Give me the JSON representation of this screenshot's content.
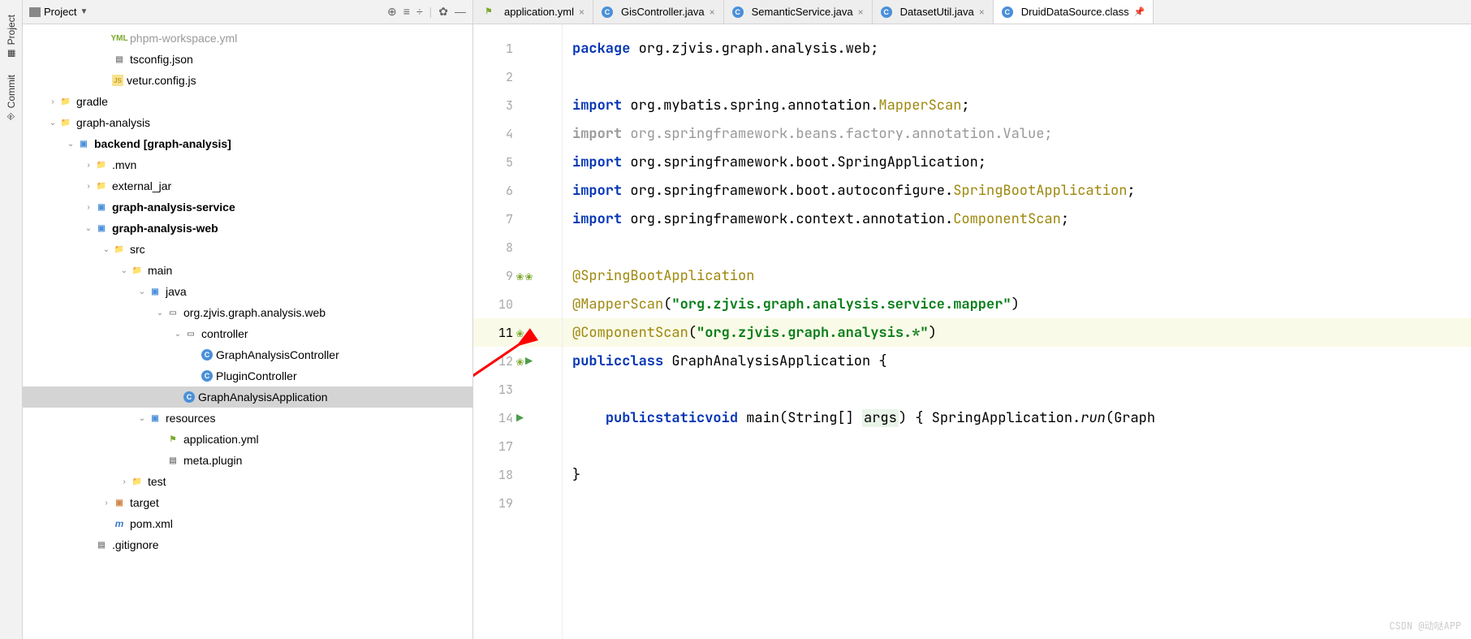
{
  "toolStrip": {
    "project": "Project",
    "commit": "Commit"
  },
  "projectPanel": {
    "title": "Project"
  },
  "tree": [
    {
      "indent": 4,
      "chev": "none",
      "icon": "yml",
      "iconText": "YML",
      "label": "phpm-workspace.yml",
      "faded": true
    },
    {
      "indent": 4,
      "chev": "none",
      "icon": "file",
      "iconText": "",
      "label": "tsconfig.json"
    },
    {
      "indent": 4,
      "chev": "none",
      "icon": "js",
      "iconText": "JS",
      "label": "vetur.config.js"
    },
    {
      "indent": 1,
      "chev": "right",
      "icon": "folder",
      "iconText": "",
      "label": "gradle"
    },
    {
      "indent": 1,
      "chev": "down",
      "icon": "folder",
      "iconText": "",
      "label": "graph-analysis"
    },
    {
      "indent": 2,
      "chev": "down",
      "icon": "module",
      "iconText": "",
      "label": "backend",
      "qualifier": "[graph-analysis]",
      "bold": true
    },
    {
      "indent": 3,
      "chev": "right",
      "icon": "folder",
      "iconText": "",
      "label": ".mvn"
    },
    {
      "indent": 3,
      "chev": "right",
      "icon": "folder",
      "iconText": "",
      "label": "external_jar"
    },
    {
      "indent": 3,
      "chev": "right",
      "icon": "module",
      "iconText": "",
      "label": "graph-analysis-service",
      "bold": true
    },
    {
      "indent": 3,
      "chev": "down",
      "icon": "module",
      "iconText": "",
      "label": "graph-analysis-web",
      "bold": true
    },
    {
      "indent": 4,
      "chev": "down",
      "icon": "folder",
      "iconText": "",
      "label": "src"
    },
    {
      "indent": 5,
      "chev": "down",
      "icon": "folder",
      "iconText": "",
      "label": "main"
    },
    {
      "indent": 6,
      "chev": "down",
      "icon": "src",
      "iconText": "",
      "label": "java"
    },
    {
      "indent": 7,
      "chev": "down",
      "icon": "pkg",
      "iconText": "",
      "label": "org.zjvis.graph.analysis.web"
    },
    {
      "indent": 8,
      "chev": "down",
      "icon": "pkg",
      "iconText": "",
      "label": "controller"
    },
    {
      "indent": 9,
      "chev": "none",
      "icon": "class",
      "iconText": "C",
      "label": "GraphAnalysisController"
    },
    {
      "indent": 9,
      "chev": "none",
      "icon": "class",
      "iconText": "C",
      "label": "PluginController"
    },
    {
      "indent": 8,
      "chev": "none",
      "icon": "class-run",
      "iconText": "C",
      "label": "GraphAnalysisApplication",
      "selected": true
    },
    {
      "indent": 6,
      "chev": "down",
      "icon": "res",
      "iconText": "",
      "label": "resources"
    },
    {
      "indent": 7,
      "chev": "none",
      "icon": "yml",
      "iconText": "",
      "label": "application.yml"
    },
    {
      "indent": 7,
      "chev": "none",
      "icon": "file",
      "iconText": "",
      "label": "meta.plugin"
    },
    {
      "indent": 5,
      "chev": "right",
      "icon": "folder",
      "iconText": "",
      "label": "test"
    },
    {
      "indent": 4,
      "chev": "right",
      "icon": "target",
      "iconText": "",
      "label": "target"
    },
    {
      "indent": 4,
      "chev": "none",
      "icon": "maven",
      "iconText": "m",
      "label": "pom.xml"
    },
    {
      "indent": 3,
      "chev": "none",
      "icon": "file",
      "iconText": "",
      "label": ".gitignore"
    }
  ],
  "editorTabs": [
    {
      "icon": "yml",
      "label": "application.yml",
      "active": false
    },
    {
      "icon": "class",
      "label": "GisController.java",
      "active": false
    },
    {
      "icon": "class",
      "label": "SemanticService.java",
      "active": false
    },
    {
      "icon": "class",
      "label": "DatasetUtil.java",
      "active": false
    },
    {
      "icon": "class",
      "label": "DruidDataSource.class",
      "active": true,
      "pinned": true
    }
  ],
  "code": {
    "lineNumbers": [
      "1",
      "2",
      "3",
      "4",
      "5",
      "6",
      "7",
      "8",
      "9",
      "10",
      "11",
      "12",
      "13",
      "14",
      "17",
      "18",
      "19"
    ],
    "highlighted": 11,
    "lines": {
      "l1_kw": "package",
      "l1_path": " org.zjvis.graph.analysis.web;",
      "l3_kw": "import",
      "l3_path": " org.mybatis.spring.annotation.",
      "l3_cls": "MapperScan",
      "l3_end": ";",
      "l4_kw": "import",
      "l4_path": " org.springframework.beans.factory.annotation.Value;",
      "l5_kw": "import",
      "l5_path": " org.springframework.boot.SpringApplication;",
      "l6_kw": "import",
      "l6_path": " org.springframework.boot.autoconfigure.",
      "l6_cls": "SpringBootApplication",
      "l6_end": ";",
      "l7_kw": "import",
      "l7_path": " org.springframework.context.annotation.",
      "l7_cls": "ComponentScan",
      "l7_end": ";",
      "l9": "@SpringBootApplication",
      "l10_ann": "@MapperScan",
      "l10_p1": "(",
      "l10_str": "\"org.zjvis.graph.analysis.service.mapper\"",
      "l10_p2": ")",
      "l11_ann": "@ComponentScan",
      "l11_p1": "(",
      "l11_str": "\"org.zjvis.graph.analysis.*\"",
      "l11_p2": ")",
      "l12_kw1": "public",
      "l12_kw2": "class",
      "l12_cls": " GraphAnalysisApplication {",
      "l14_pre": "    ",
      "l14_kw1": "public",
      "l14_kw2": "static",
      "l14_kw3": "void",
      "l14_m": " main(String[] ",
      "l14_arg": "args",
      "l14_p": ") { ",
      "l14_call1": "SpringApplication.",
      "l14_call2": "run",
      "l14_rest": "(Graph",
      "l18": "}"
    }
  },
  "watermark": "CSDN @动哒APP"
}
